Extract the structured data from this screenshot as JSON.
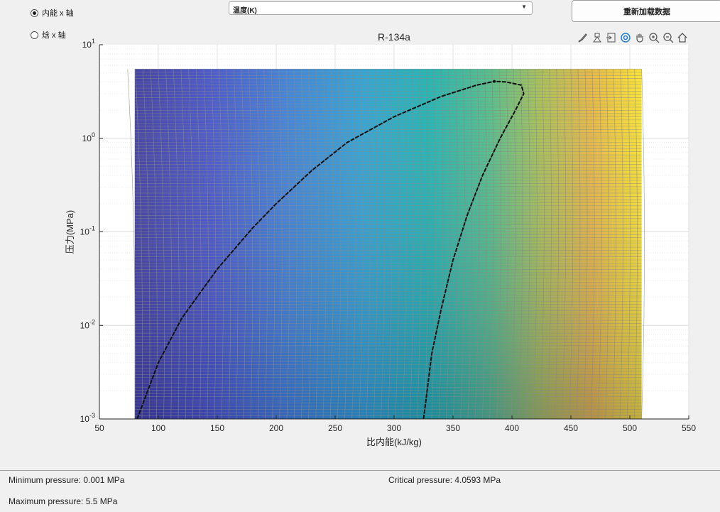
{
  "controls": {
    "radio_internal_energy": "内能 x 轴",
    "radio_enthalpy": "焓 x 轴",
    "selected_axis": "internal_energy",
    "dropdown_value": "温度(K)",
    "reload_button": "重新加载数据"
  },
  "status": {
    "min_pressure": "Minimum pressure: 0.001 MPa",
    "max_pressure": "Maximum pressure: 5.5 MPa",
    "critical_pressure": "Critical pressure: 4.0593 MPa"
  },
  "toolbar": {
    "icons": [
      "brush-icon",
      "data-tips-icon",
      "axis-export-icon",
      "rotate-icon",
      "pan-hand-icon",
      "zoom-in-icon",
      "zoom-out-icon",
      "home-icon"
    ]
  },
  "chart_data": {
    "type": "heatmap",
    "title": "R-134a",
    "xlabel": "比内能(kJ/kg)",
    "ylabel": "压力(MPa)",
    "xlim": [
      50,
      550
    ],
    "xticks": [
      50,
      100,
      150,
      200,
      250,
      300,
      350,
      400,
      450,
      500,
      550
    ],
    "yscale": "log",
    "ylim": [
      0.001,
      10
    ],
    "yticks": [
      {
        "base": "10",
        "exp": "-3"
      },
      {
        "base": "10",
        "exp": "-2"
      },
      {
        "base": "10",
        "exp": "-1"
      },
      {
        "base": "10",
        "exp": "0"
      },
      {
        "base": "10",
        "exp": "1"
      }
    ],
    "grid": true,
    "colormap": "parula",
    "colored_region": {
      "x": [
        80,
        510
      ],
      "y": [
        0.001,
        5.5
      ]
    },
    "critical_point": {
      "x": 385,
      "y": 4.0593
    },
    "saturated_liquid_line": [
      {
        "x": 82,
        "y": 0.001
      },
      {
        "x": 100,
        "y": 0.004
      },
      {
        "x": 120,
        "y": 0.012
      },
      {
        "x": 150,
        "y": 0.04
      },
      {
        "x": 180,
        "y": 0.11
      },
      {
        "x": 200,
        "y": 0.2
      },
      {
        "x": 230,
        "y": 0.45
      },
      {
        "x": 260,
        "y": 0.9
      },
      {
        "x": 300,
        "y": 1.7
      },
      {
        "x": 340,
        "y": 2.8
      },
      {
        "x": 370,
        "y": 3.7
      },
      {
        "x": 385,
        "y": 4.0593
      }
    ],
    "saturated_vapor_line": [
      {
        "x": 325,
        "y": 0.001
      },
      {
        "x": 332,
        "y": 0.005
      },
      {
        "x": 340,
        "y": 0.015
      },
      {
        "x": 350,
        "y": 0.05
      },
      {
        "x": 362,
        "y": 0.15
      },
      {
        "x": 375,
        "y": 0.4
      },
      {
        "x": 390,
        "y": 1.0
      },
      {
        "x": 403,
        "y": 2.0
      },
      {
        "x": 410,
        "y": 3.0
      },
      {
        "x": 408,
        "y": 3.7
      },
      {
        "x": 395,
        "y": 4.0
      },
      {
        "x": 385,
        "y": 4.0593
      }
    ]
  }
}
